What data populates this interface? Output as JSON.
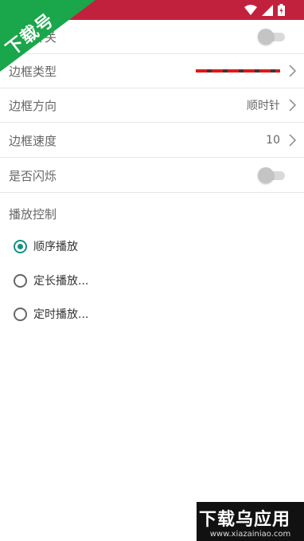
{
  "status_bar": {
    "color": "#c2213d"
  },
  "rows": {
    "row0": {
      "label": "边框开关",
      "toggle_on": false
    },
    "border_type": {
      "label": "边框类型"
    },
    "border_direction": {
      "label": "边框方向",
      "value": "顺时针"
    },
    "border_speed": {
      "label": "边框速度",
      "value": "10"
    },
    "blink": {
      "label": "是否闪烁",
      "toggle_on": false
    }
  },
  "playback": {
    "title": "播放控制",
    "options": [
      {
        "label": "顺序播放",
        "checked": true
      },
      {
        "label": "定长播放...",
        "checked": false
      },
      {
        "label": "定时播放...",
        "checked": false
      }
    ]
  },
  "watermark": {
    "corner_text": "下载号",
    "bottom_text": "下载乌应用",
    "bottom_url": "www.xiazainiao.com"
  },
  "accent_color": "#159085"
}
